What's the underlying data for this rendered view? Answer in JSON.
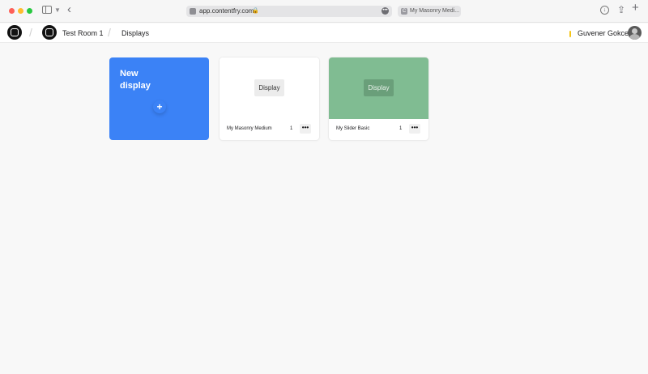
{
  "browser": {
    "url": "app.contentfry.com",
    "tab_title": "My Masonry Medi...",
    "tab_favicon": "C"
  },
  "header": {
    "breadcrumb": {
      "room": "Test Room 1",
      "page": "Displays"
    },
    "user_name": "Guvener Gokce"
  },
  "cards": {
    "new_display_label": "New display",
    "new_display_plus": "+",
    "items": [
      {
        "name": "My Masonry Medium",
        "count": "1",
        "preview_label": "Display",
        "preview_color": "#ffffff"
      },
      {
        "name": "My Slider Basic",
        "count": "1",
        "preview_label": "Display",
        "preview_color": "#80bc92"
      }
    ],
    "more_label": "•••"
  },
  "colors": {
    "accent": "#3b82f6",
    "slider_preview": "#80bc92"
  }
}
